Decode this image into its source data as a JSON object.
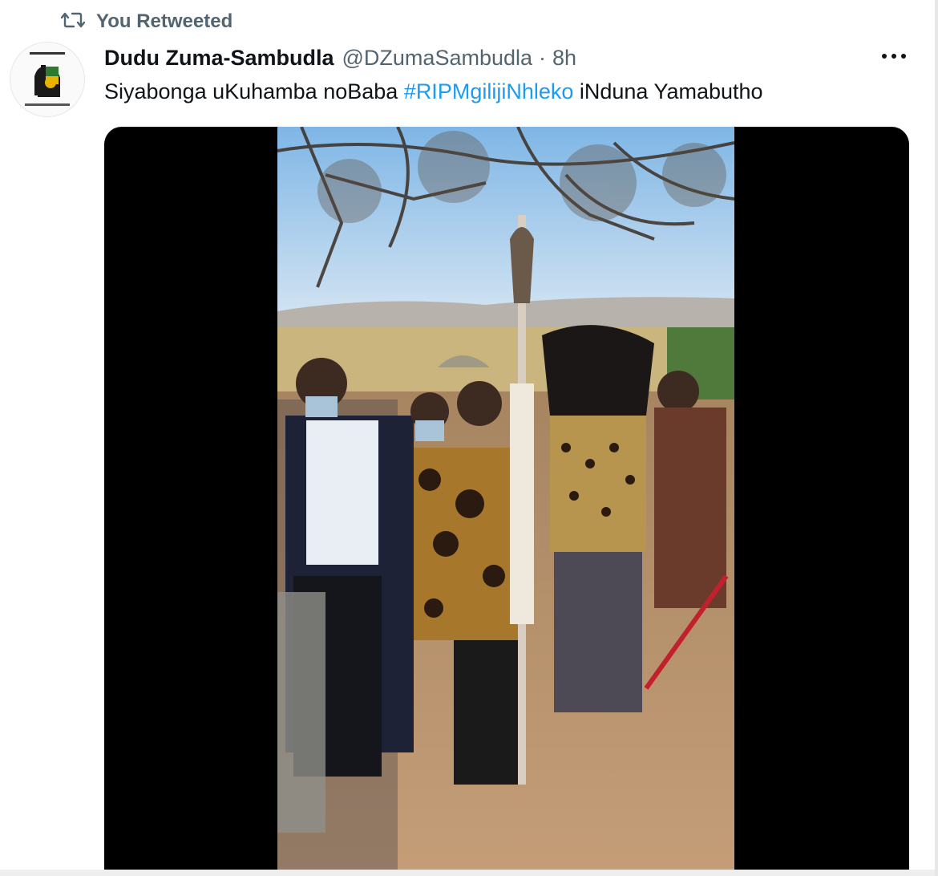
{
  "retweet": {
    "label": "You Retweeted",
    "icon": "retweet-icon"
  },
  "author": {
    "display_name": "Dudu Zuma-Sambudla",
    "handle": "@DZumaSambudla",
    "separator": "·",
    "time": "8h",
    "avatar_icon": "anc-logo-avatar"
  },
  "tweet": {
    "text_before": "Siyabonga uKuhamba noBaba ",
    "hashtag": "#RIPMgilijiNhleko",
    "text_after": " iNduna Yamabutho"
  },
  "actions": {
    "more_icon": "more-icon"
  },
  "media": {
    "type": "video",
    "icon": "video-thumbnail"
  },
  "colors": {
    "text": "#0f1419",
    "secondary": "#536471",
    "link": "#1d9bf0",
    "media_background": "#000000"
  }
}
